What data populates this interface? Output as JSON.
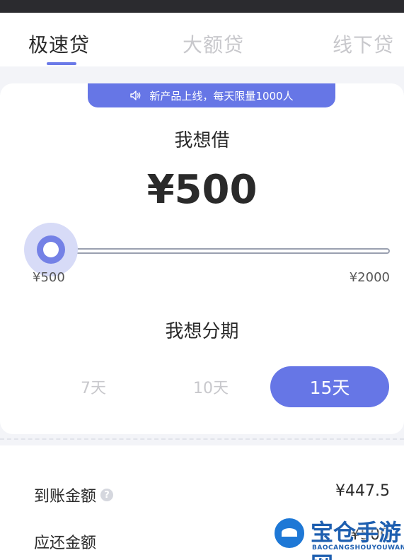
{
  "tabs": [
    {
      "label": "极速贷",
      "active": true
    },
    {
      "label": "大额贷",
      "active": false
    },
    {
      "label": "线下贷",
      "active": false
    }
  ],
  "notice": {
    "icon": "speaker-icon",
    "text": "新产品上线，每天限量1000人"
  },
  "borrow": {
    "label": "我想借",
    "amount": "¥500",
    "slider": {
      "min_label": "¥500",
      "max_label": "¥2000",
      "value_fraction": 0
    }
  },
  "period": {
    "label": "我想分期",
    "options": [
      {
        "label": "7天",
        "selected": false
      },
      {
        "label": "10天",
        "selected": false
      },
      {
        "label": "15天",
        "selected": true
      }
    ]
  },
  "summary": {
    "rows": [
      {
        "label": "到账金额",
        "value": "¥447.5",
        "help_icon": true
      },
      {
        "label": "应还金额",
        "value": "¥500",
        "help_icon": false
      }
    ]
  },
  "watermark": {
    "title": "宝仓手游网",
    "subtitle": "BAOCANGSHOUYOUWANG"
  },
  "colors": {
    "accent": "#6676e6",
    "accent_light": "#d7dbf7",
    "inactive_text": "#c8c8cc",
    "background": "#f3f4f8"
  }
}
